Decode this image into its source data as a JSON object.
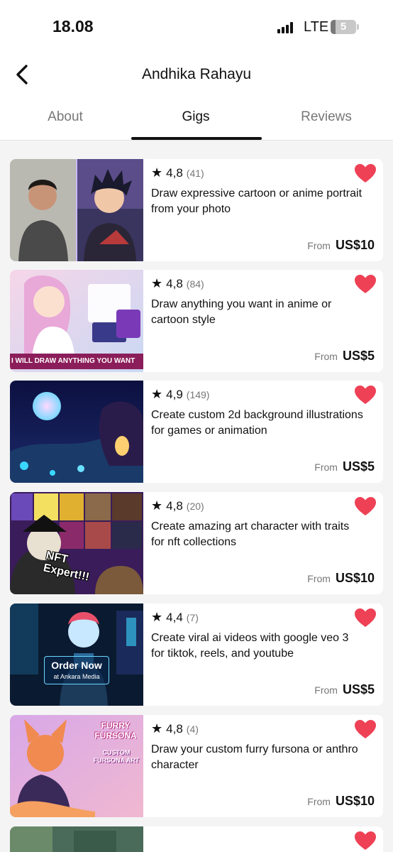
{
  "status_bar": {
    "time": "18.08",
    "network": "LTE",
    "battery": "5"
  },
  "header": {
    "title": "Andhika Rahayu",
    "back_icon": "chevron-left-icon"
  },
  "tabs": [
    {
      "label": "About",
      "active": false
    },
    {
      "label": "Gigs",
      "active": true
    },
    {
      "label": "Reviews",
      "active": false
    }
  ],
  "gigs": [
    {
      "rating": "4,8",
      "count": "(41)",
      "title": "Draw expressive cartoon or anime portrait from your photo",
      "from": "From",
      "price": "US$10",
      "favorited": true
    },
    {
      "rating": "4,8",
      "count": "(84)",
      "title": "Draw anything you want in anime or cartoon style",
      "from": "From",
      "price": "US$5",
      "favorited": true,
      "thumb_banner": "I WILL DRAW ANYTHING YOU WANT"
    },
    {
      "rating": "4,9",
      "count": "(149)",
      "title": "Create custom 2d background illustrations for games or animation",
      "from": "From",
      "price": "US$5",
      "favorited": true
    },
    {
      "rating": "4,8",
      "count": "(20)",
      "title": "Create amazing art character with traits for nft collections",
      "from": "From",
      "price": "US$10",
      "favorited": true,
      "thumb_text": "NFT Expert!!!"
    },
    {
      "rating": "4,4",
      "count": "(7)",
      "title": "Create viral ai videos with google veo 3 for tiktok, reels, and youtube",
      "from": "From",
      "price": "US$5",
      "favorited": true,
      "thumb_text": "Order Now",
      "thumb_subtext": "at Ankara Media"
    },
    {
      "rating": "4,8",
      "count": "(4)",
      "title": "Draw your custom furry fursona or anthro character",
      "from": "From",
      "price": "US$10",
      "favorited": true,
      "thumb_text": "FURRY FURSONA",
      "thumb_subtext": "CUSTOM FURSONA ART"
    }
  ],
  "colors": {
    "heart": "#ee4155",
    "text": "#111111",
    "muted": "#777777",
    "background": "#f4f4f5"
  }
}
